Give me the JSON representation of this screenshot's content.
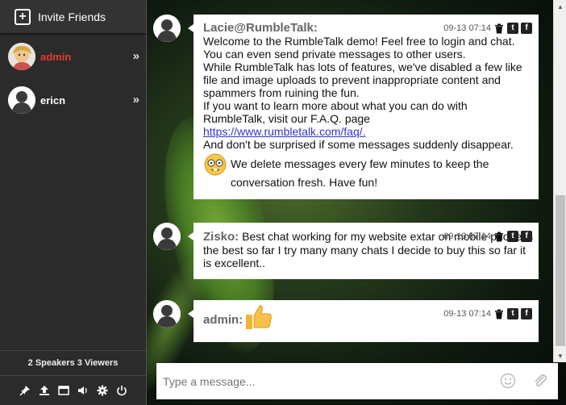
{
  "sidebar": {
    "invite_label": "Invite Friends",
    "users": [
      {
        "name": "admin",
        "color": "#e23b2e"
      },
      {
        "name": "ericn",
        "color": "#ffffff"
      }
    ],
    "stats": "2 Speakers 3 Viewers",
    "toolbar_icons": [
      "pin-icon",
      "upload-icon",
      "window-icon",
      "speaker-icon",
      "gear-icon",
      "power-icon"
    ]
  },
  "messages": [
    {
      "author": "Lacie@RumbleTalk:",
      "time": "09-13 07:14",
      "lines": [
        "Welcome to the RumbleTalk demo! Feel free to login and chat.",
        "You can even send private messages to other users.",
        "While RumbleTalk has lots of features, we've disabled a few like file and image uploads to prevent inappropriate content and spammers from ruining the fun.",
        "If you want to learn more about what you can do with RumbleTalk, visit our F.A.Q. page"
      ],
      "link": "https://www.rumbletalk.com/faq/.",
      "after_link": "And don't be surprised if some messages suddenly disappear.",
      "emoji_text": "We delete messages every few minutes to keep the conversation fresh. Have fun!"
    },
    {
      "author": "Zisko:",
      "time": "09-13 07:14",
      "text": "Best chat working for my website extar on mobile phone is the best so far I try many many chats I decide to buy this so far it is excellent.."
    },
    {
      "author": "admin:",
      "time": "09-13 07:14",
      "emoji": "thumbs-up-icon"
    }
  ],
  "input": {
    "placeholder": "Type a message..."
  },
  "colors": {
    "sidebar_bg": "#2b2b2b",
    "admin_name": "#e23b2e",
    "link": "#3333cc"
  }
}
